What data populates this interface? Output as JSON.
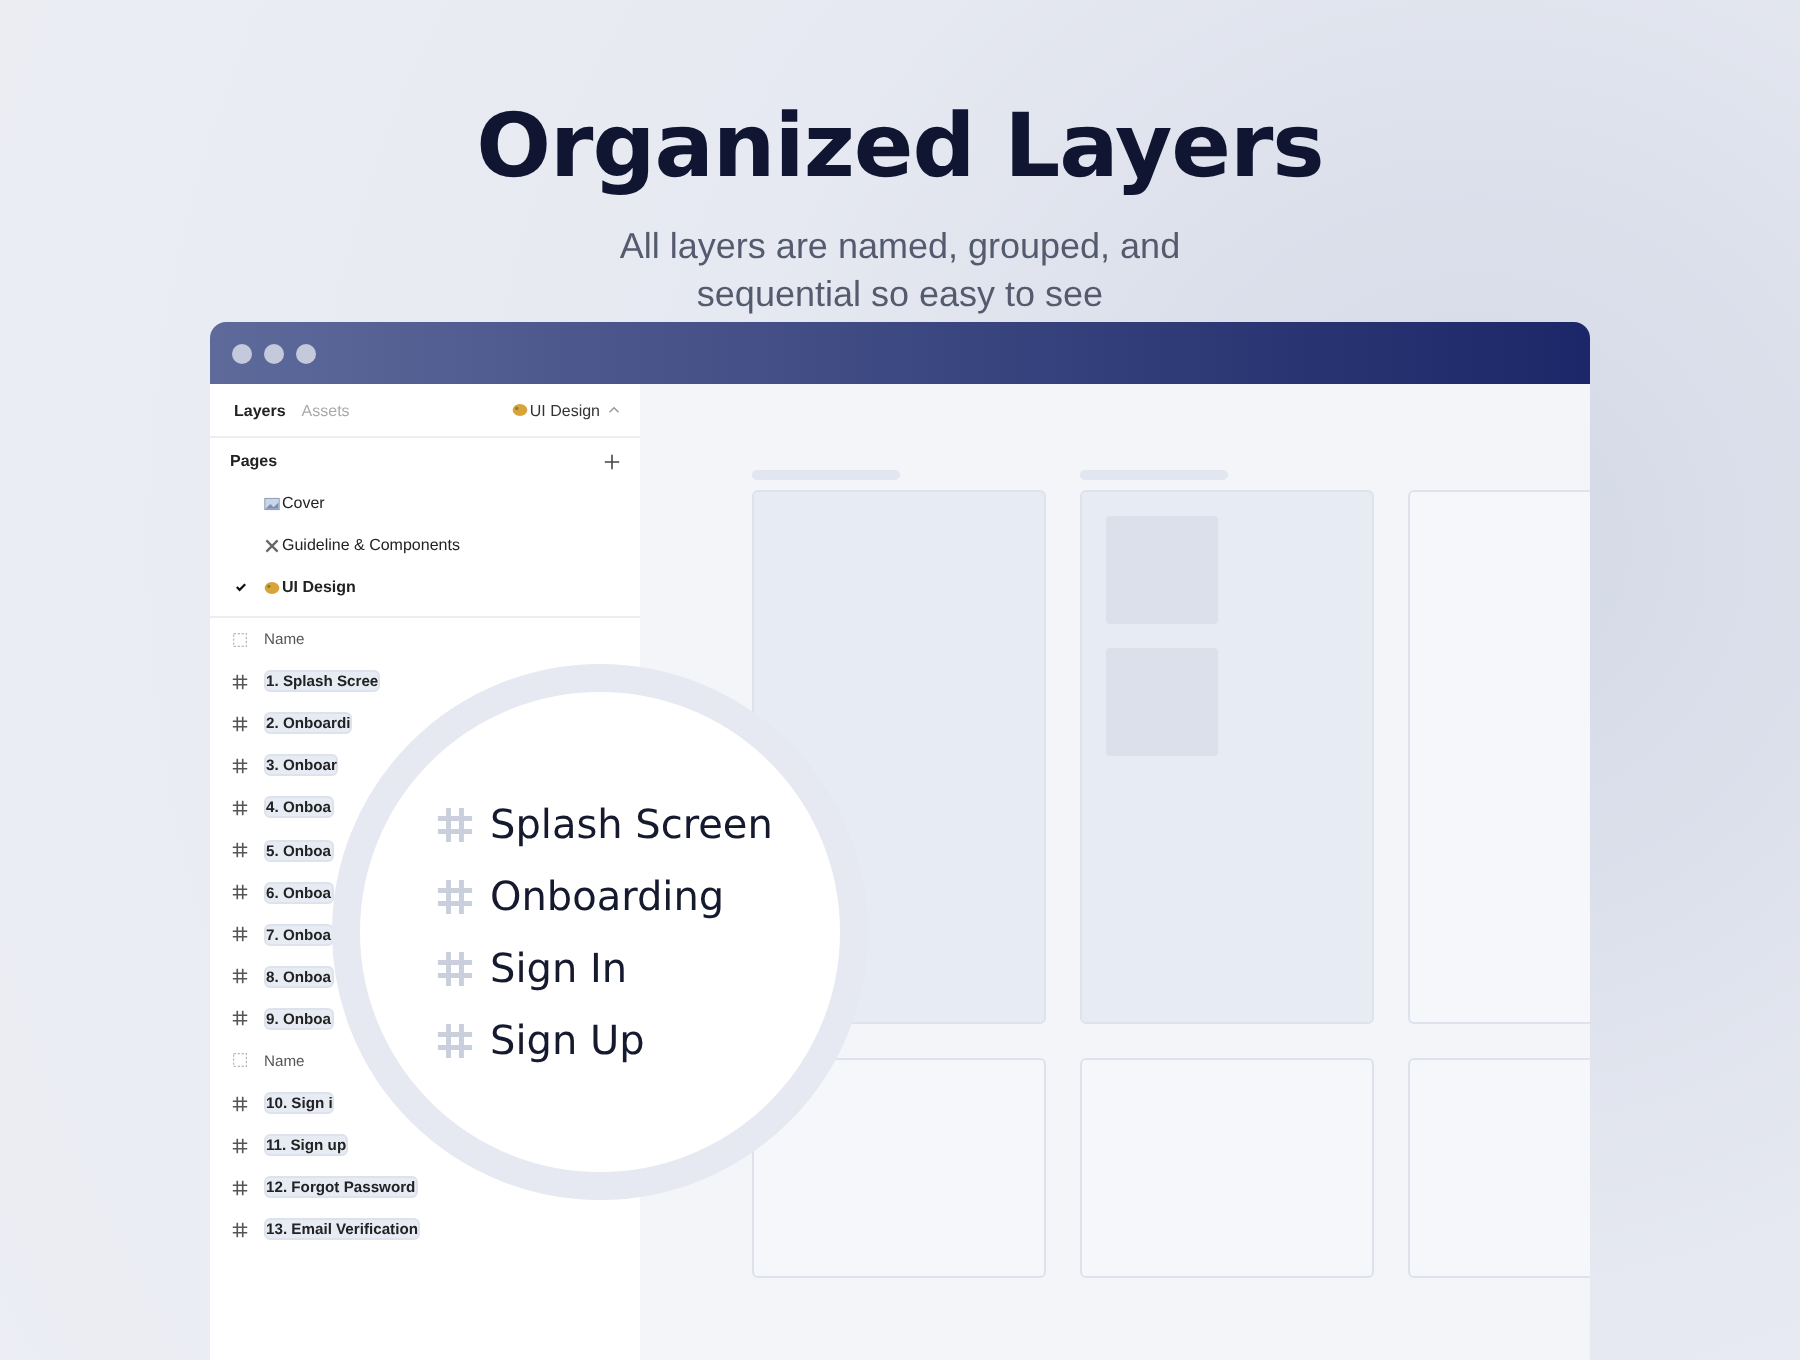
{
  "headline": "Organized Layers",
  "subtitle": "All layers are named, grouped, and sequential so easy to see",
  "tabs": [
    {
      "label": "Layers",
      "selected": true
    },
    {
      "label": "Assets",
      "selected": false
    }
  ],
  "page_switcher": "UI Design",
  "pages_header": "Pages",
  "pages": [
    {
      "label": "Cover",
      "selected": false
    },
    {
      "label": "Guideline & Components",
      "selected": false
    },
    {
      "label": "UI Design",
      "selected": true
    }
  ],
  "layers": [
    {
      "kind": "group",
      "label": "Name"
    },
    {
      "kind": "frame",
      "label": "1. Splash Scree"
    },
    {
      "kind": "frame",
      "label": "2. Onboardi"
    },
    {
      "kind": "frame",
      "label": "3. Onboar"
    },
    {
      "kind": "frame",
      "label": "4. Onboa"
    },
    {
      "kind": "frame",
      "label": "5. Onboa"
    },
    {
      "kind": "frame",
      "label": "6. Onboa"
    },
    {
      "kind": "frame",
      "label": "7. Onboa"
    },
    {
      "kind": "frame",
      "label": "8. Onboa"
    },
    {
      "kind": "frame",
      "label": "9. Onboa"
    },
    {
      "kind": "group",
      "label": "Name"
    },
    {
      "kind": "frame",
      "label": "10. Sign i"
    },
    {
      "kind": "frame",
      "label": "11. Sign up"
    },
    {
      "kind": "frame",
      "label": "12. Forgot Password"
    },
    {
      "kind": "frame",
      "label": "13. Email Verification"
    }
  ],
  "magnifier": [
    "Splash Screen",
    "Onboarding",
    "Sign In",
    "Sign Up"
  ]
}
